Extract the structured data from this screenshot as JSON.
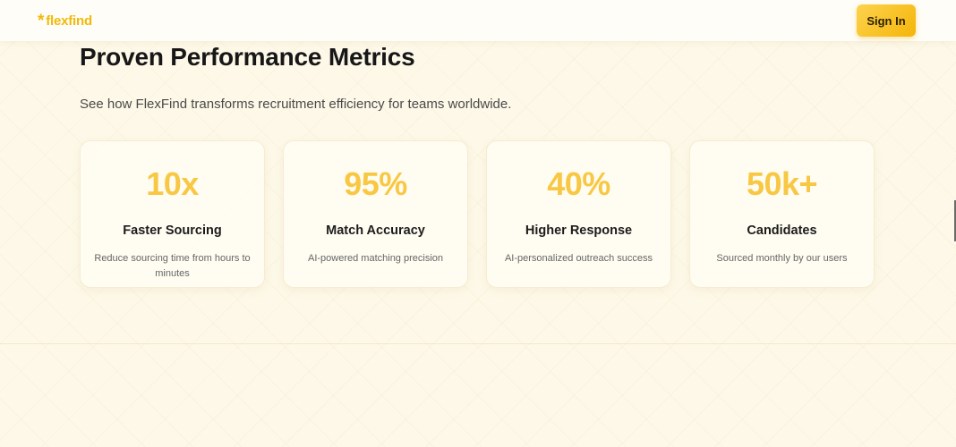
{
  "nav": {
    "logo_mark": "*",
    "logo_text": "flexfind",
    "signin_label": "Sign In"
  },
  "main": {
    "title": "Proven Performance Metrics",
    "subtitle": "See how FlexFind transforms recruitment efficiency for teams worldwide.",
    "metrics": [
      {
        "value": "10x",
        "title": "Faster Sourcing",
        "desc": "Reduce sourcing time from hours to minutes"
      },
      {
        "value": "95%",
        "title": "Match Accuracy",
        "desc": "AI-powered matching precision"
      },
      {
        "value": "40%",
        "title": "Higher Response",
        "desc": "AI-personalized outreach success"
      },
      {
        "value": "50k+",
        "title": "Candidates",
        "desc": "Sourced monthly by our users"
      }
    ]
  },
  "colors": {
    "accent": "#f5b50a",
    "metric_value": "#f8c844",
    "background": "#fdf8e8"
  }
}
